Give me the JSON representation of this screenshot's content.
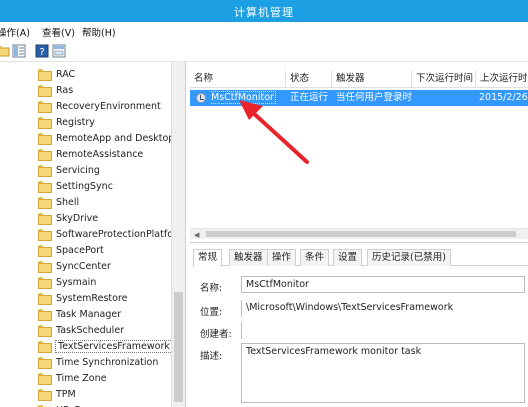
{
  "window": {
    "title": "计算机管理"
  },
  "menu": [
    "操作(A)",
    "查看(V)",
    "帮助(H)"
  ],
  "tree": {
    "items": [
      "RAC",
      "Ras",
      "RecoveryEnvironment",
      "Registry",
      "RemoteApp and Desktop",
      "RemoteAssistance",
      "Servicing",
      "SettingSync",
      "Shell",
      "SkyDrive",
      "SoftwareProtectionPlatforr",
      "SpacePort",
      "SyncCenter",
      "Sysmain",
      "SystemRestore",
      "Task Manager",
      "TaskScheduler",
      "TextServicesFramework",
      "Time Synchronization",
      "Time Zone",
      "TPM",
      "UPnP"
    ],
    "selected": "TextServicesFramework"
  },
  "task_list": {
    "columns": [
      "名称",
      "状态",
      "触发器",
      "下次运行时间",
      "上次运行时"
    ],
    "rows": [
      {
        "name": "MsCtfMonitor",
        "status": "正在运行",
        "trigger": "当任何用户登录时",
        "next_run": "",
        "last_run": "2015/2/26"
      }
    ]
  },
  "details": {
    "tabs": [
      "常规",
      "触发器",
      "操作",
      "条件",
      "设置",
      "历史记录(已禁用)"
    ],
    "active_tab": "常规",
    "name_label": "名称:",
    "name_value": "MsCtfMonitor",
    "location_label": "位置:",
    "location_value": "\\Microsoft\\Windows\\TextServicesFramework",
    "author_label": "创建者:",
    "author_value": "",
    "description_label": "描述:",
    "description_value": "TextServicesFramework monitor task"
  },
  "colors": {
    "titlebar": "#1d9fe3",
    "selection": "#3399ff",
    "arrow": "#e8242a"
  }
}
